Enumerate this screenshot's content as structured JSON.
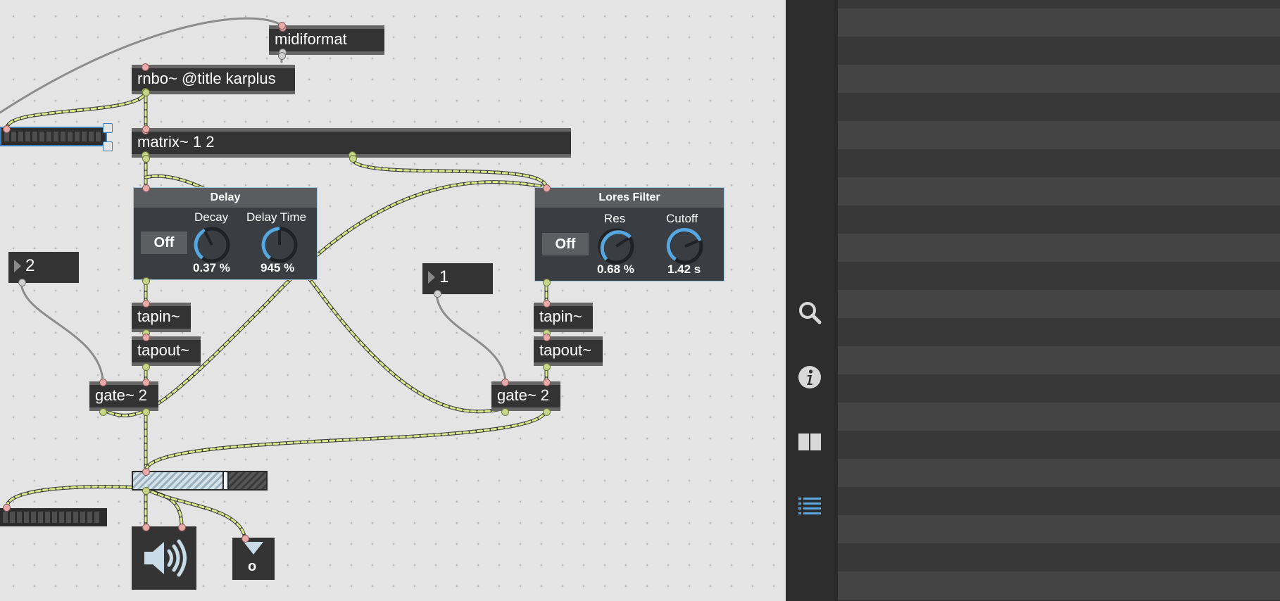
{
  "objects": {
    "midiformat": "midiformat",
    "rnbo": "rnbo~ @title karplus",
    "matrix": "matrix~ 1 2",
    "tapin_left": "tapin~",
    "tapout_left": "tapout~",
    "tapin_right": "tapin~",
    "tapout_right": "tapout~",
    "gate_left": "gate~ 2",
    "gate_right": "gate~ 2"
  },
  "number_boxes": {
    "left": "2",
    "right": "1"
  },
  "delay_patcher": {
    "title": "Delay",
    "toggle_label": "Off",
    "decay_label": "Decay",
    "decay_value": "0.37 %",
    "delay_time_label": "Delay Time",
    "delay_time_value": "945 %"
  },
  "filter_patcher": {
    "title": "Lores Filter",
    "toggle_label": "Off",
    "res_label": "Res",
    "res_value": "0.68 %",
    "cutoff_label": "Cutoff",
    "cutoff_value": "1.42 s"
  },
  "output_number": "o",
  "gain_level": 0.72,
  "colors": {
    "accent": "#56a7e0",
    "wire_signal": "#d9e98a",
    "object_bg": "#333333",
    "canvas_bg": "#e4e4e4"
  },
  "sidebar_icons": [
    "search-icon",
    "info-icon",
    "reference-icon",
    "list-icon"
  ],
  "sidebar_active": "list-icon"
}
